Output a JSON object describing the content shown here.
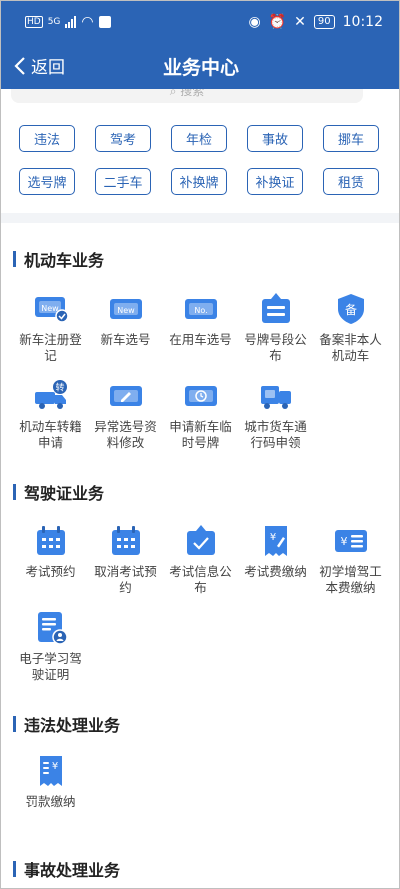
{
  "status": {
    "carrier_left": "HD",
    "network": "5G",
    "battery": "90",
    "time": "10:12"
  },
  "header": {
    "back_label": "返回",
    "title": "业务中心"
  },
  "search": {
    "placeholder": "搜索"
  },
  "quick_tags": [
    "违法",
    "驾考",
    "年检",
    "事故",
    "挪车",
    "选号牌",
    "二手车",
    "补换牌",
    "补换证",
    "租赁"
  ],
  "sections": [
    {
      "title": "机动车业务",
      "items": [
        {
          "label": "新车注册登记",
          "icon": "new-plate-check-icon"
        },
        {
          "label": "新车选号",
          "icon": "new-plate-icon"
        },
        {
          "label": "在用车选号",
          "icon": "no-plate-icon"
        },
        {
          "label": "号牌号段公布",
          "icon": "notice-board-icon"
        },
        {
          "label": "备案非本人机动车",
          "icon": "record-shield-icon"
        },
        {
          "label": "机动车转籍申请",
          "icon": "truck-transfer-icon"
        },
        {
          "label": "异常选号资料修改",
          "icon": "edit-card-icon"
        },
        {
          "label": "申请新车临时号牌",
          "icon": "clock-plate-icon"
        },
        {
          "label": "城市货车通行码申领",
          "icon": "truck-pass-icon"
        }
      ]
    },
    {
      "title": "驾驶证业务",
      "items": [
        {
          "label": "考试预约",
          "icon": "calendar-icon"
        },
        {
          "label": "取消考试预约",
          "icon": "calendar-cancel-icon"
        },
        {
          "label": "考试信息公布",
          "icon": "exam-notice-icon"
        },
        {
          "label": "考试费缴纳",
          "icon": "fee-receipt-icon"
        },
        {
          "label": "初学增驾工本费缴纳",
          "icon": "fee-card-icon"
        },
        {
          "label": "电子学习驾驶证明",
          "icon": "study-certificate-icon"
        }
      ]
    },
    {
      "title": "违法处理业务",
      "items": [
        {
          "label": "罚款缴纳",
          "icon": "fine-receipt-icon"
        }
      ]
    },
    {
      "title": "事故处理业务",
      "items": []
    }
  ],
  "colors": {
    "brand": "#2b64b5",
    "icon_light": "#3b83e6",
    "background": "#ffffff"
  }
}
